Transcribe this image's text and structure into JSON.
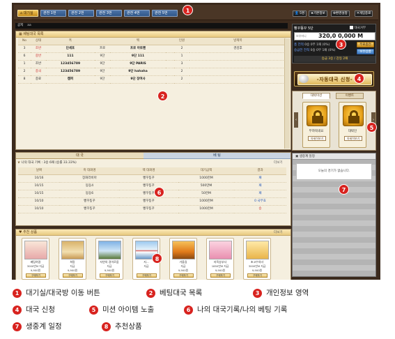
{
  "topbar": {
    "tabs": [
      "대기실",
      "관전 1번",
      "관전 2번",
      "관전 3번",
      "관전 4번",
      "관전 5번"
    ],
    "buttons": [
      "5명",
      "기본정보",
      "환경설정",
      "게임종료"
    ]
  },
  "notice": {
    "label": "공지",
    "text": "aa"
  },
  "betting_list": {
    "title": "베팅대국 목록",
    "columns": [
      "No",
      "상태",
      "흑",
      "",
      "백",
      "",
      "인원",
      "방제목"
    ],
    "rows": [
      {
        "no": "3",
        "status": "조반",
        "black": "단세포",
        "brank": "프로",
        "white": "프로 아토펜",
        "wrank": "",
        "people": "2",
        "title": "경김후",
        "red": true
      },
      {
        "no": "6",
        "status": "중반",
        "black": "111",
        "brank": "9단",
        "white": "9단 111",
        "wrank": "",
        "people": "1",
        "title": "",
        "red": true
      },
      {
        "no": "1",
        "status": "조반",
        "black": "123456789",
        "brank": "9단",
        "white": "9단 PARIS",
        "wrank": "",
        "people": "3",
        "title": "",
        "red": false
      },
      {
        "no": "2",
        "status": "종국",
        "black": "123456789",
        "brank": "9단",
        "white": "9단 hahaha",
        "wrank": "",
        "people": "2",
        "title": "",
        "red": true
      },
      {
        "no": "8",
        "status": "종료",
        "black": "캠퍼",
        "brank": "9단",
        "white": "9단 장여사",
        "wrank": "",
        "people": "2",
        "title": "",
        "red": false
      }
    ]
  },
  "profile": {
    "name": "빵꾸똥꾸 5단",
    "money_label": "보유머니",
    "money": "320,0 0,000 M",
    "record_label": "총 전적",
    "record": "0승 0무 1패 (0%)",
    "today_label": "승급전 전적",
    "today": "0승 0무 1패 (0%)",
    "rank_up": "승급 3승 / 강등 2패",
    "charge_button": "무료충전",
    "detail_button": "보유상품",
    "checkbox_label": "대국거부"
  },
  "apply": {
    "label": "-자동대국 신청-"
  },
  "mission": {
    "tabs": [
      "대박미션",
      "이벤트"
    ],
    "cards": [
      {
        "name": "뚜까묵네요",
        "button": "자세히보기"
      },
      {
        "name": "대박인",
        "button": "자세히보기"
      }
    ]
  },
  "schedule": {
    "title": "생중계 일정",
    "empty": "오늘의 경기가 없습니다."
  },
  "history": {
    "tabs": [
      "대 국",
      "베 팅"
    ],
    "summary": "나의 대국 기록 : 3승 6패 (승률 33.33%)",
    "more": "더보기",
    "columns": [
      "날짜",
      "흑 대화명",
      "백 대화명",
      "대기금액",
      "결과"
    ],
    "rows": [
      {
        "date": "10/16",
        "black": "장화라비아",
        "white": "빵꾸똥꾸",
        "amount": "1000만M",
        "result": "패"
      },
      {
        "date": "10/15",
        "black": "동동4",
        "white": "빵꾸똥꾸",
        "amount": "500만M",
        "result": "패"
      },
      {
        "date": "10/15",
        "black": "동동6",
        "white": "빵꾸똥꾸",
        "amount": "50만M",
        "result": "패"
      },
      {
        "date": "10/10",
        "black": "빵꾸똥꾸",
        "white": "빵꾸똥꾸",
        "amount": "1000만M",
        "result": "0 국무효"
      },
      {
        "date": "10/10",
        "black": "빵꾸똥꾸",
        "white": "빵꾸똥꾸",
        "amount": "1000만M",
        "result": "승"
      }
    ]
  },
  "recommend": {
    "title": "추천 상품",
    "more": "더보기",
    "items": [
      {
        "name": "베팅여걸",
        "price": "3000만M 지급",
        "sub": "9,900원",
        "buy": "구매하기"
      },
      {
        "name": "희망",
        "price": "지급",
        "sub": "9,900원",
        "buy": "구매하기"
      },
      {
        "name": "자연의 경이로움",
        "price": "지급",
        "sub": "9,900원",
        "buy": "구매하기"
      },
      {
        "name": "지...",
        "price": "지급",
        "sub": "",
        "buy": "구매하기"
      },
      {
        "name": "가을길",
        "price": "지급",
        "sub": "9,900원",
        "buy": "구매하기"
      },
      {
        "name": "자옥승부사",
        "price": "1850만M 지급",
        "sub": "9,900원",
        "buy": "구매하기"
      },
      {
        "name": "초고수의녀",
        "price": "3000만M 지급",
        "sub": "9,900원",
        "buy": "구매하기"
      }
    ]
  },
  "legend": [
    {
      "n": "1",
      "text": "대기실/대국방 이동 버튼"
    },
    {
      "n": "2",
      "text": "베팅대국 목록"
    },
    {
      "n": "3",
      "text": "개인정보 영역"
    },
    {
      "n": "4",
      "text": "대국 신청"
    },
    {
      "n": "5",
      "text": "미션 아이템 노출"
    },
    {
      "n": "6",
      "text": "나의 대국기록/나의 베팅 기록"
    },
    {
      "n": "7",
      "text": "생중계 일정"
    },
    {
      "n": "8",
      "text": "추천상품"
    }
  ],
  "colors": {
    "accent": "#d8231f",
    "frame": "#3b2a1d",
    "panel": "#f5efdf"
  }
}
